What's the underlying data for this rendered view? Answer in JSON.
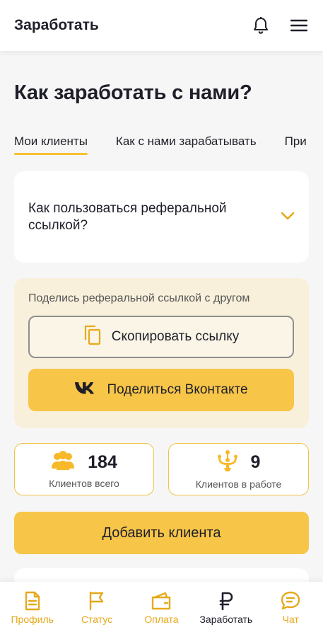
{
  "header": {
    "title": "Заработать",
    "bell_icon": "bell-icon",
    "menu_icon": "hamburger-menu-icon"
  },
  "page_title": "Как заработать с нами?",
  "tabs": [
    {
      "label": "Мои клиенты",
      "active": true
    },
    {
      "label": "Как с нами зарабатывать",
      "active": false
    },
    {
      "label": "При",
      "active": false
    }
  ],
  "faq": {
    "question": "Как пользоваться реферальной ссылкой?",
    "icon": "chevron-down-icon"
  },
  "referral": {
    "label": "Поделись реферальной ссылкой с другом",
    "copy_button": "Скопировать ссылку",
    "vk_button": "Поделиться Вконтакте"
  },
  "stats": [
    {
      "value": "184",
      "label": "Клиентов всего",
      "icon": "people-icon"
    },
    {
      "value": "9",
      "label": "Клиентов в работе",
      "icon": "chandelier-icon"
    }
  ],
  "add_client_button": "Добавить клиента",
  "bottom_nav": [
    {
      "label": "Профиль",
      "icon": "document-icon",
      "active": false
    },
    {
      "label": "Статус",
      "icon": "flag-icon",
      "active": false
    },
    {
      "label": "Оплата",
      "icon": "wallet-icon",
      "active": false
    },
    {
      "label": "Заработать",
      "icon": "ruble-icon",
      "active": true
    },
    {
      "label": "Чат",
      "icon": "chat-icon",
      "active": false
    }
  ],
  "colors": {
    "accent": "#f7c548",
    "accent_dark": "#e6a91a",
    "referral_bg": "#f9f0dc",
    "background": "#f6f6f6"
  }
}
